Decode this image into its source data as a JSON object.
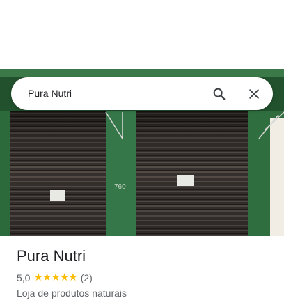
{
  "search": {
    "query": "Pura Nutri",
    "search_icon": "search-icon",
    "close_icon": "close-icon"
  },
  "photo": {
    "street_number": "760"
  },
  "place": {
    "name": "Pura Nutri",
    "rating": "5,0",
    "stars": 5,
    "review_count": "(2)",
    "category": "Loja de produtos naturais"
  },
  "colors": {
    "star": "#fbbc04",
    "wall_green": "#2f6b3d",
    "shutter": "#3a3431"
  }
}
